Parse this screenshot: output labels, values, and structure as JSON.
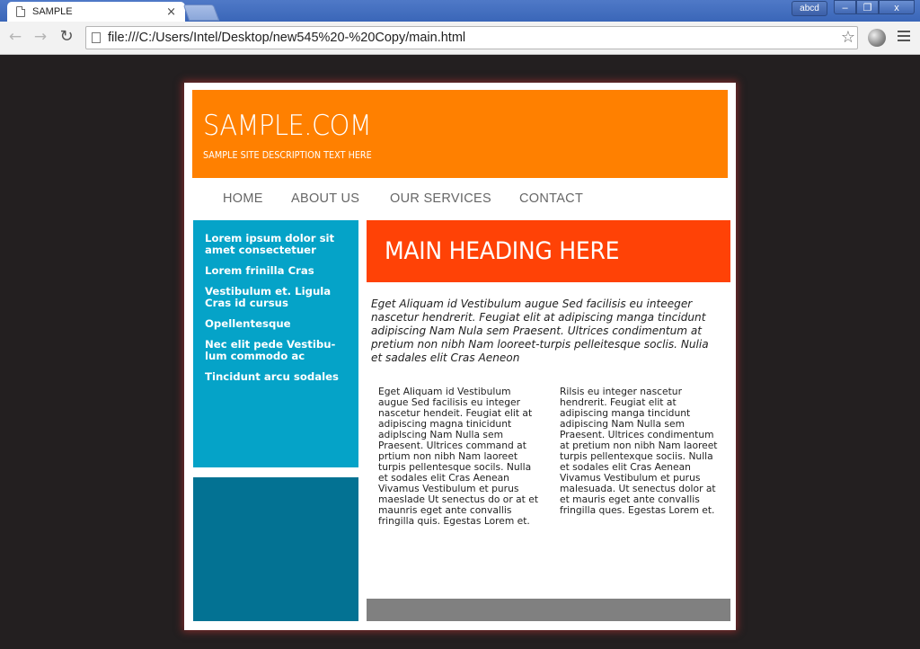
{
  "browser": {
    "tab_title": "SAMPLE",
    "tab_close": "×",
    "profile": "abcd",
    "url": "file:///C:/Users/Intel/Desktop/new545%20-%20Copy/main.html",
    "win_min": "–",
    "win_max": "❐",
    "win_close": "x"
  },
  "site": {
    "title": "SAMPLE.COM",
    "description": "SAMPLE SITE DESCRIPTION TEXT HERE"
  },
  "nav": [
    "HOME",
    "ABOUT US",
    "OUR SERVICES",
    "CONTACT"
  ],
  "sidebar": {
    "links": [
      "Lorem ipsum dolor sit amet consectetuer",
      "Lorem frinilla Cras",
      "Vestibulum et. Ligula Cras id cursus",
      "Opellentesque",
      "Nec elit pede Vestibu-lum commodo ac",
      "Tincidunt arcu sodales"
    ]
  },
  "main": {
    "heading": "MAIN HEADING HERE",
    "intro": "Eget Aliquam id Vestibulum augue Sed facilisis eu inteeger nascetur hendrerit. Feugiat elit at adipiscing manga tincidunt adipiscing Nam Nula sem Praesent. Ultrices condimentum at pretium non nibh Nam looreet-turpis pelleitesque soclis. Nulia et sadales elit Cras Aeneon",
    "col_left": "Eget Aliquam id Vestibulum augue Sed facilisis eu integer nascetur hendeit. Feugiat elit at adipiscing magna tinicidunt adiplscing Nam Nulla sem Praesent. Ultrices command at prtium non nibh Nam laoreet turpis pellentesque socils. Nulla et sodales elit Cras Aenean Vivamus Vestibulum et purus maeslade Ut senectus do or at et maunris eget ante convallis fringilla quis. Egestas Lorem et.",
    "col_right": "Rilsis eu integer nascetur hendrerit. Feugiat elit at adipiscing manga tincidunt adipiscing Nam Nulla sem Praesent. Ultrices condimentum at pretium non nibh Nam laoreet turpis pellentexque sociis. Nulla et sodales elit Cras Aenean Vivamus Vestibulum et purus malesuada. Ut senectus dolor at et mauris eget ante convallis fringilla ques. Egestas Lorem et."
  },
  "colors": {
    "header": "#ff8000",
    "heading_box": "#ff4206",
    "sidebar": "#05a3c8",
    "sidebar_box": "#037293",
    "footer_bar": "#808080",
    "background": "#231f20"
  }
}
